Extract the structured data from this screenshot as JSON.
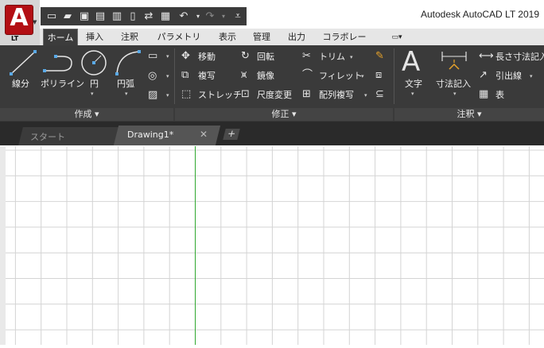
{
  "app": {
    "title": "Autodesk AutoCAD LT 2019",
    "logo_letter": "A",
    "logo_sub": "LT"
  },
  "qat": {
    "icons": [
      "new-icon",
      "open-icon",
      "save-icon",
      "saveas-icon",
      "publish-icon",
      "share-icon",
      "plot-icon",
      "undo-icon",
      "redo-icon",
      "customize-icon"
    ]
  },
  "tabs": [
    "ホーム",
    "挿入",
    "注釈",
    "パラメトリック",
    "表示",
    "管理",
    "出力",
    "コラボレート"
  ],
  "ribbon": {
    "draw": {
      "line": "線分",
      "polyline": "ポリライン",
      "circle": "円",
      "arc": "円弧",
      "panel": "作成 ▾"
    },
    "modify": {
      "move": "移動",
      "rotate": "回転",
      "trim": "トリム",
      "copy": "複写",
      "mirror": "鏡像",
      "fillet": "フィレット",
      "stretch": "ストレッチ",
      "scale": "尺度変更",
      "array": "配列複写",
      "panel": "修正 ▾"
    },
    "annotation": {
      "text": "文字",
      "dimension": "寸法記入",
      "linear": "長さ寸法記入",
      "leader": "引出線",
      "table": "表",
      "panel": "注釈 ▾"
    }
  },
  "doc_tabs": {
    "start": "スタート",
    "drawing": "Drawing1*",
    "close": "✕",
    "add": "+"
  },
  "colors": {
    "ribbon_bg": "#3a3a3a",
    "grid_minor": "#d4d4d4",
    "grid_major": "#b8b8b8",
    "y_axis": "#2fa82f"
  }
}
